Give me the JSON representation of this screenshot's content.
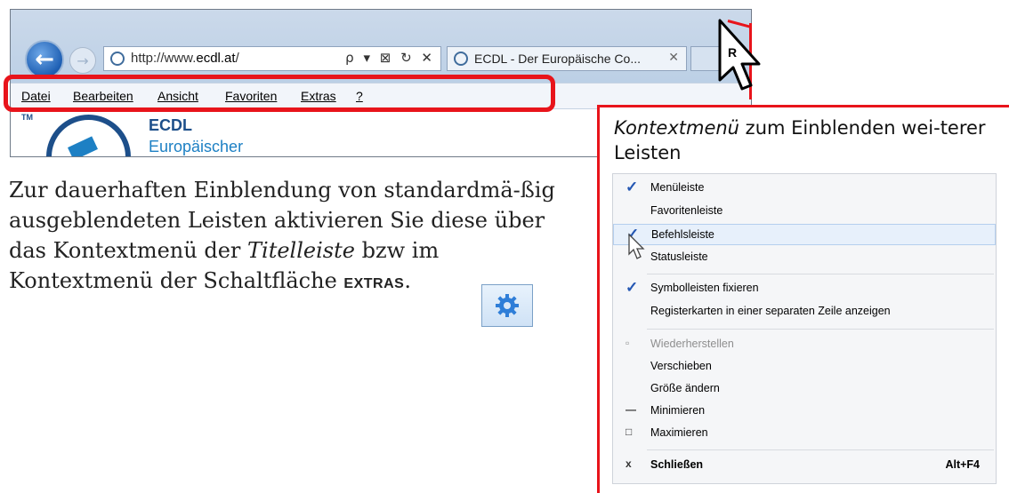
{
  "browser": {
    "url_prefix": "http://www.",
    "url_domain": "ecdl.at",
    "url_suffix": "/",
    "address_tools": "ρ ▾ ⊠ ↻ ✕",
    "tab_title": "ECDL - Der Europäische Co...",
    "tab_close": "✕",
    "back_glyph": "←",
    "forward_glyph": "→",
    "menu": [
      {
        "label": "Datei"
      },
      {
        "label": "Bearbeiten"
      },
      {
        "label": "Ansicht"
      },
      {
        "label": "Favoriten"
      },
      {
        "label": "Extras"
      },
      {
        "label": "?"
      }
    ],
    "page_tm": "TM",
    "page_brand": "ECDL",
    "page_brand_sub": "Europäischer",
    "cursor_letter": "R",
    "highlight_color": "#e8141b"
  },
  "body": {
    "text_part1": "Zur dauerhaften Einblendung von standardmä-ßig ausgeblendeten Leisten aktivieren Sie diese über das Kontextmenü der ",
    "text_italic": "Titelleiste",
    "text_part2": " bzw im Kontextmenü der Schaltfläche ",
    "text_smallcaps": "EXTRAS",
    "text_end": ".",
    "gear_icon": "gear-icon"
  },
  "panel": {
    "caption_italic": "Kontextmenü",
    "caption_rest": " zum Einblenden wei-terer Leisten",
    "items": [
      {
        "label": "Menüleiste",
        "checked": "✓"
      },
      {
        "label": "Favoritenleiste",
        "checked": ""
      },
      {
        "label": "Befehlsleiste",
        "checked": "✓"
      },
      {
        "label": "Statusleiste",
        "checked": ""
      },
      {
        "label": "Symbolleisten fixieren",
        "checked": "✓"
      },
      {
        "label": "Registerkarten in einer separaten Zeile anzeigen",
        "checked": ""
      },
      {
        "label": "Wiederherstellen",
        "icon": "▫"
      },
      {
        "label": "Verschieben"
      },
      {
        "label": "Größe ändern"
      },
      {
        "label": "Minimieren",
        "icon": "—"
      },
      {
        "label": "Maximieren",
        "icon": "□"
      },
      {
        "label": "Schließen",
        "icon": "x",
        "accel": "Alt+F4"
      }
    ]
  }
}
